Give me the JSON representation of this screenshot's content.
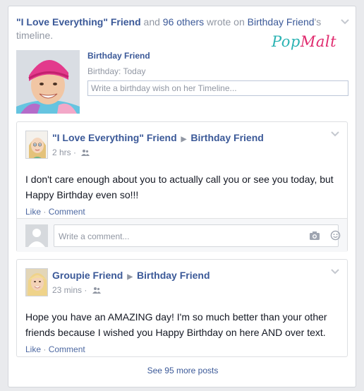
{
  "header": {
    "friend1": "\"I Love Everything\" Friend",
    "and_text": " and ",
    "others": "96 others",
    "wrote_on": " wrote on ",
    "birthday_friend": "Birthday Friend",
    "possessive": "'s",
    "timeline": "timeline."
  },
  "logo": {
    "pop": "Pop",
    "malt": "Malt"
  },
  "birthday": {
    "name": "Birthday Friend",
    "date": "Birthday: Today",
    "placeholder": "Write a birthday wish on her Timeline..."
  },
  "posts": [
    {
      "author": "\"I Love Everything\" Friend",
      "target": "Birthday Friend",
      "time": "2 hrs",
      "body": "I don't care enough about you to actually call you or see you today, but Happy Birthday even so!!!",
      "like": "Like",
      "sep": " · ",
      "comment": "Comment",
      "comment_placeholder": "Write a comment..."
    },
    {
      "author": "Groupie Friend",
      "target": "Birthday Friend",
      "time": "23 mins",
      "body": "Hope you have an AMAZING day! I'm so much better than your other friends because I wished you Happy Birthday on here AND over text.",
      "like": "Like",
      "sep": " · ",
      "comment": "Comment"
    }
  ],
  "footer": {
    "see_more": "See 95 more posts"
  },
  "colors": {
    "link": "#3b5998",
    "muted": "#9197a3",
    "brand_pop": "#2bb3b3",
    "brand_malt": "#e02a6e"
  }
}
